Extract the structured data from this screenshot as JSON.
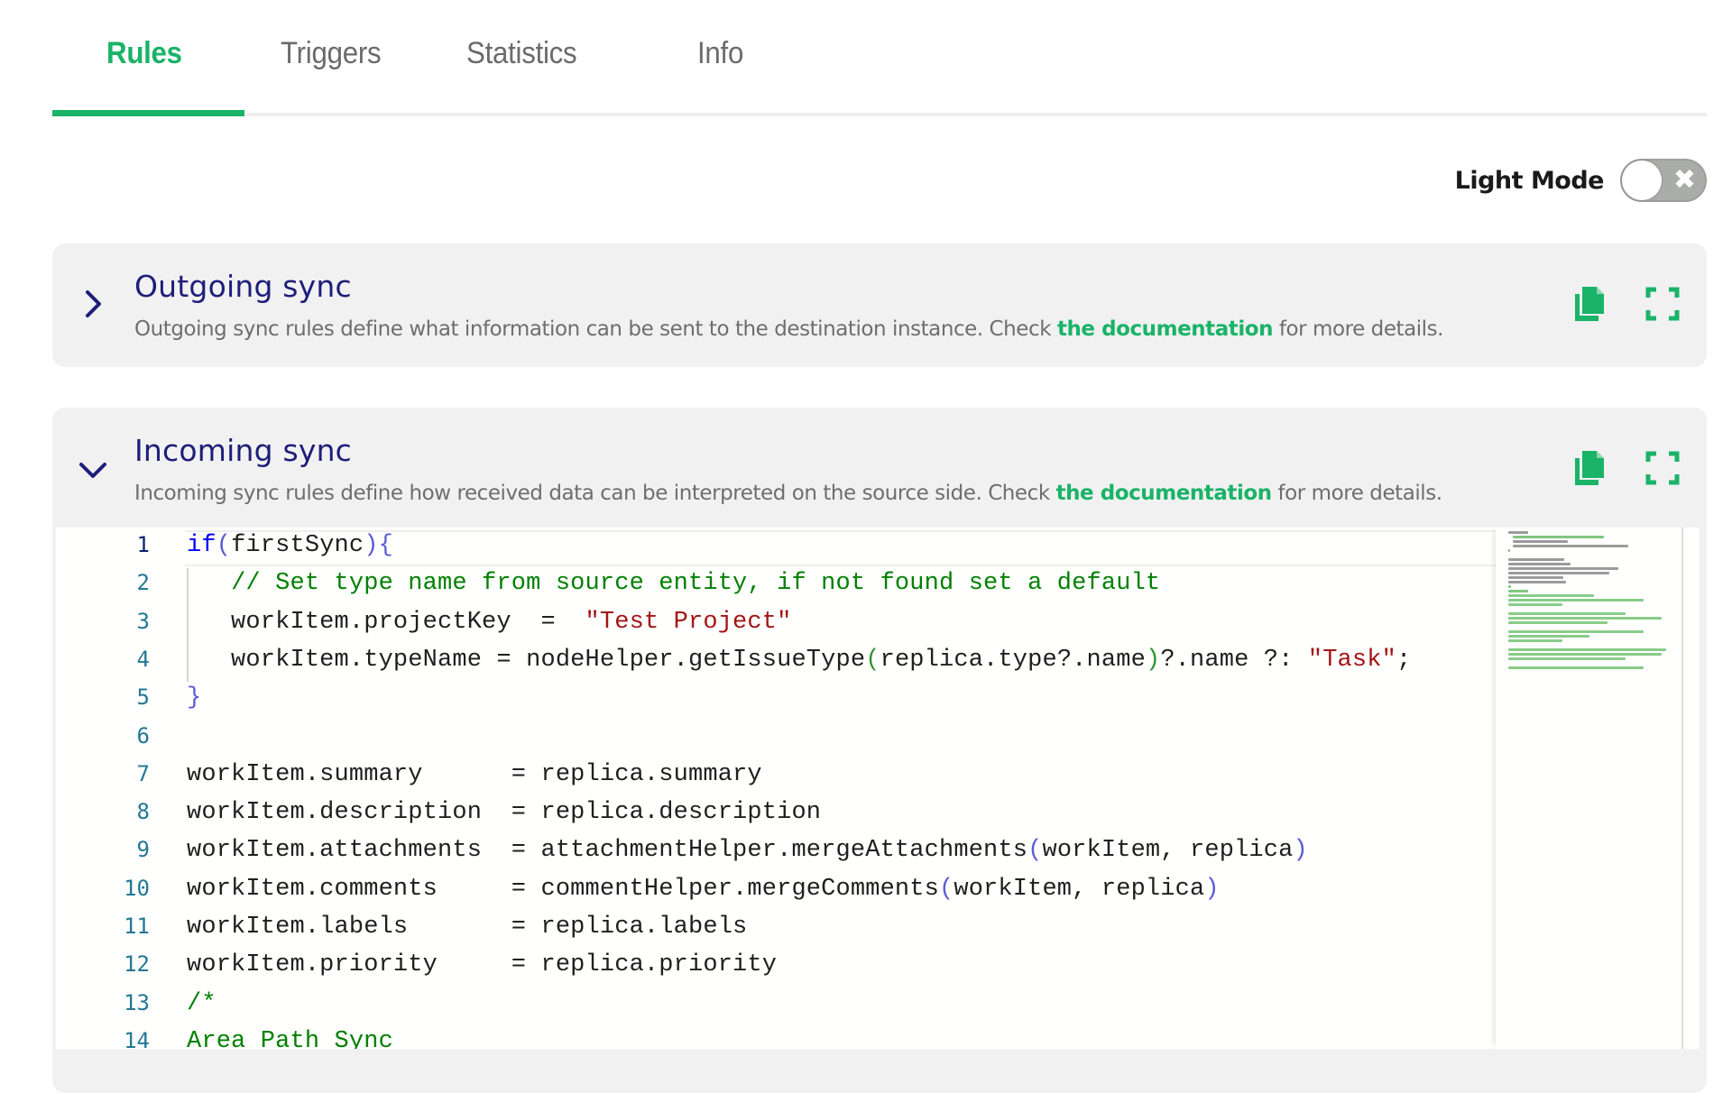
{
  "tabs": [
    {
      "label": "Rules",
      "active": true
    },
    {
      "label": "Triggers",
      "active": false
    },
    {
      "label": "Statistics",
      "active": false
    },
    {
      "label": "Info",
      "active": false
    }
  ],
  "mode_toggle": {
    "label": "Light Mode",
    "enabled": false,
    "off_glyph": "✖"
  },
  "sections": {
    "outgoing": {
      "title": "Outgoing sync",
      "expanded": false,
      "desc_before": "Outgoing sync rules define what information can be sent to the destination instance. Check ",
      "link": "the documentation",
      "desc_after": " for more details.",
      "icons": [
        "copy-icon",
        "fullscreen-icon"
      ]
    },
    "incoming": {
      "title": "Incoming sync",
      "expanded": true,
      "desc_before": "Incoming sync rules define how received data can be interpreted on the source side. Check ",
      "link": "the documentation",
      "desc_after": " for more details.",
      "icons": [
        "copy-icon",
        "fullscreen-icon"
      ]
    }
  },
  "editor": {
    "active_line": 1,
    "lines": [
      {
        "n": "1",
        "tokens": [
          [
            "kw",
            "if"
          ],
          [
            "br1",
            "("
          ],
          [
            "",
            "firstSync"
          ],
          [
            "br1",
            "){"
          ]
        ]
      },
      {
        "n": "2",
        "tokens": [
          [
            "",
            "   "
          ],
          [
            "cm",
            "// Set type name from source entity, if not found set a default"
          ]
        ]
      },
      {
        "n": "3",
        "tokens": [
          [
            "",
            "   workItem.projectKey  =  "
          ],
          [
            "str",
            "\"Test Project\""
          ]
        ]
      },
      {
        "n": "4",
        "tokens": [
          [
            "",
            "   workItem.typeName = nodeHelper.getIssueType"
          ],
          [
            "br2",
            "("
          ],
          [
            "",
            "replica.type?.name"
          ],
          [
            "br2",
            ")"
          ],
          [
            "",
            "?.name ?: "
          ],
          [
            "str",
            "\"Task\""
          ],
          [
            "",
            ";"
          ]
        ]
      },
      {
        "n": "5",
        "tokens": [
          [
            "br1",
            "}"
          ]
        ]
      },
      {
        "n": "6",
        "tokens": []
      },
      {
        "n": "7",
        "tokens": [
          [
            "",
            "workItem.summary      = replica.summary"
          ]
        ]
      },
      {
        "n": "8",
        "tokens": [
          [
            "",
            "workItem.description  = replica.description"
          ]
        ]
      },
      {
        "n": "9",
        "tokens": [
          [
            "",
            "workItem.attachments  = attachmentHelper.mergeAttachments"
          ],
          [
            "br1",
            "("
          ],
          [
            "",
            "workItem, replica"
          ],
          [
            "br1",
            ")"
          ]
        ]
      },
      {
        "n": "10",
        "tokens": [
          [
            "",
            "workItem.comments     = commentHelper.mergeComments"
          ],
          [
            "br1",
            "("
          ],
          [
            "",
            "workItem, replica"
          ],
          [
            "br1",
            ")"
          ]
        ]
      },
      {
        "n": "11",
        "tokens": [
          [
            "",
            "workItem.labels       = replica.labels"
          ]
        ]
      },
      {
        "n": "12",
        "tokens": [
          [
            "",
            "workItem.priority     = replica.priority"
          ]
        ]
      },
      {
        "n": "13",
        "tokens": [
          [
            "cm",
            "/*"
          ]
        ]
      },
      {
        "n": "14",
        "tokens": [
          [
            "cm",
            "Area Path Sync"
          ]
        ]
      }
    ]
  },
  "colors": {
    "accent": "#1ab368",
    "title": "#1d1e7a",
    "card_bg": "#f1f1f1",
    "toggle_off": "#a9aca9"
  }
}
